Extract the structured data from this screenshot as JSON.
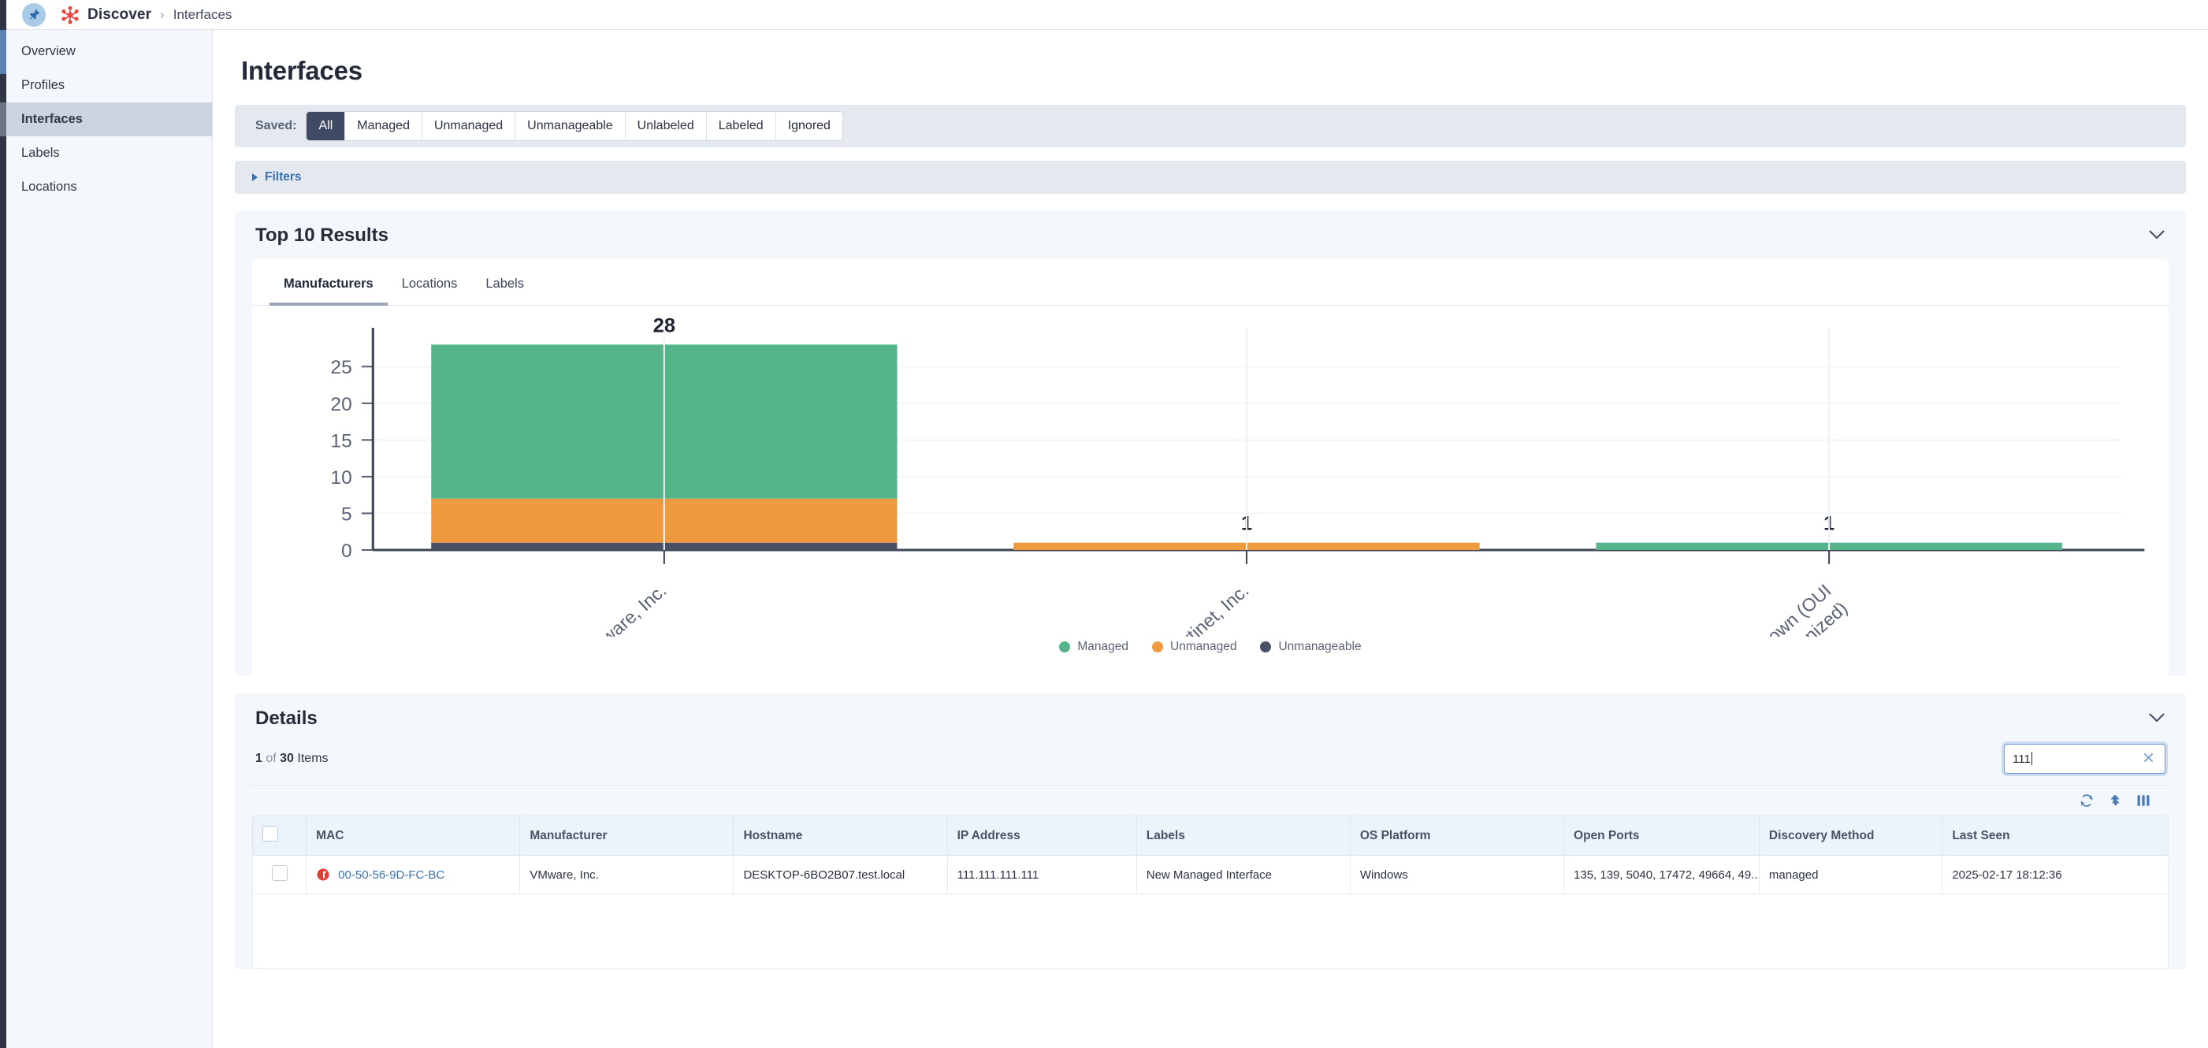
{
  "topbar": {
    "pin_icon": "pin-icon",
    "brand_icon": "discover-logo-icon",
    "brand": "Discover",
    "separator": "›",
    "breadcrumb_current": "Interfaces"
  },
  "sidebar": {
    "items": [
      {
        "label": "Overview",
        "active": false
      },
      {
        "label": "Profiles",
        "active": false
      },
      {
        "label": "Interfaces",
        "active": true
      },
      {
        "label": "Labels",
        "active": false
      },
      {
        "label": "Locations",
        "active": false
      }
    ]
  },
  "page": {
    "title": "Interfaces"
  },
  "saved": {
    "label": "Saved:",
    "buttons": [
      {
        "label": "All",
        "active": true
      },
      {
        "label": "Managed",
        "active": false
      },
      {
        "label": "Unmanaged",
        "active": false
      },
      {
        "label": "Unmanageable",
        "active": false
      },
      {
        "label": "Unlabeled",
        "active": false
      },
      {
        "label": "Labeled",
        "active": false
      },
      {
        "label": "Ignored",
        "active": false
      }
    ]
  },
  "filters": {
    "label": "Filters",
    "expanded": false,
    "icon": "triangle-right-icon"
  },
  "results_panel": {
    "title": "Top 10 Results",
    "collapse_icon": "chevron-down-icon",
    "tabs": [
      {
        "label": "Manufacturers",
        "active": true
      },
      {
        "label": "Locations",
        "active": false
      },
      {
        "label": "Labels",
        "active": false
      }
    ]
  },
  "chart_data": {
    "type": "bar",
    "stacked": true,
    "title": "",
    "xlabel": "",
    "ylabel": "",
    "categories": [
      "VMware, Inc.",
      "Fortinet, Inc.",
      "Unknown (OUI not recognized)"
    ],
    "series": [
      {
        "name": "Managed",
        "color": "#55b489",
        "values": [
          21,
          0,
          1
        ]
      },
      {
        "name": "Unmanaged",
        "color": "#ef9a3f",
        "values": [
          6,
          1,
          0
        ]
      },
      {
        "name": "Unmanageable",
        "color": "#4a5065",
        "values": [
          1,
          0,
          0
        ]
      }
    ],
    "totals": [
      28,
      1,
      1
    ],
    "total_labels": [
      "28",
      "1",
      "1"
    ],
    "yticks": [
      0,
      5,
      10,
      15,
      20,
      25
    ],
    "ylim": [
      0,
      29
    ],
    "grid": true,
    "legend_position": "bottom",
    "legend": [
      "Managed",
      "Unmanaged",
      "Unmanageable"
    ]
  },
  "details_panel": {
    "title": "Details",
    "collapse_icon": "chevron-down-icon",
    "count_current": "1",
    "count_of": "of",
    "count_total": "30",
    "count_suffix": "Items",
    "search": {
      "value": "111",
      "placeholder": "",
      "clear_icon": "close-icon"
    },
    "tools": [
      {
        "name": "refresh-icon"
      },
      {
        "name": "export-icon"
      },
      {
        "name": "columns-icon"
      }
    ],
    "columns": [
      "MAC",
      "Manufacturer",
      "Hostname",
      "IP Address",
      "Labels",
      "OS Platform",
      "Open Ports",
      "Discovery Method",
      "Last Seen"
    ],
    "rows": [
      {
        "status_icon": "alert-circle-icon",
        "mac": "00-50-56-9D-FC-BC",
        "manufacturer": "VMware, Inc.",
        "hostname": "DESKTOP-6BO2B07.test.local",
        "ip_address": "111.111.111.111",
        "labels": "New Managed Interface",
        "os_platform": "Windows",
        "open_ports": "135, 139, 5040, 17472, 49664, 49...",
        "discovery_method": "managed",
        "last_seen": "2025-02-17 18:12:36"
      }
    ]
  },
  "colors": {
    "managed": "#55b489",
    "unmanaged": "#ef9a3f",
    "unmanageable": "#4a5065",
    "accent": "#3c6fae",
    "active_button": "#3f4a66"
  }
}
